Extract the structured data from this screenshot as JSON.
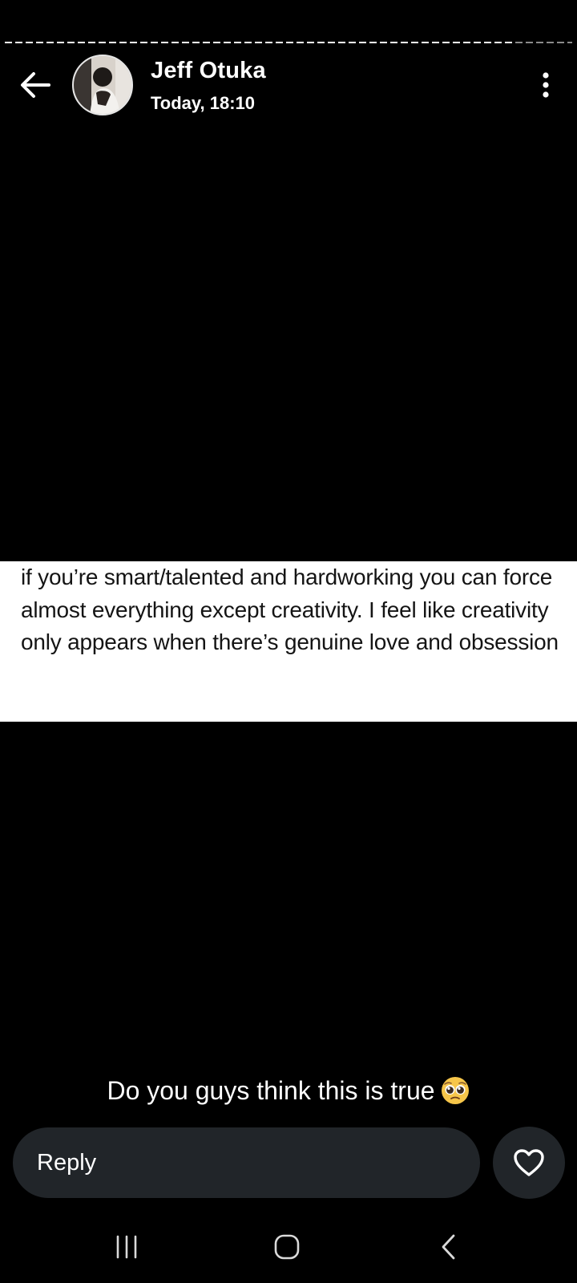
{
  "story": {
    "progress": 0.9,
    "header": {
      "name": "Jeff Otuka",
      "timestamp": "Today, 18:10",
      "back_icon": "arrow-left-icon",
      "more_icon": "more-vertical-icon"
    },
    "post_text": "if you’re smart/talented and hardworking you can force almost everything except creativity. I feel like creativity only appears when there’s genuine love and obsession",
    "caption": "Do you guys think this is true",
    "caption_emoji": "pleading-face-emoji"
  },
  "reply": {
    "placeholder": "Reply",
    "like_icon": "heart-icon"
  },
  "navbar": {
    "items": [
      "recents-icon",
      "home-icon",
      "back-icon"
    ]
  },
  "colors": {
    "background": "#000000",
    "reply_bar": "#212529",
    "text": "#ffffff",
    "post_background": "#ffffff",
    "post_text": "#141414"
  }
}
